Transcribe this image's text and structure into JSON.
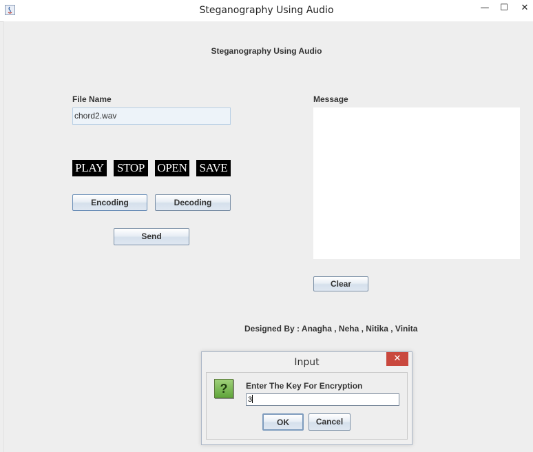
{
  "window": {
    "title": "Steganography Using Audio",
    "min": "—",
    "max": "☐",
    "close": "✕"
  },
  "heading": "Steganography Using Audio",
  "file_section": {
    "label": "File Name",
    "value": "chord2.wav"
  },
  "media_buttons": {
    "play": "PLAY",
    "stop": "STOP",
    "open": "OPEN",
    "save": "SAVE"
  },
  "actions": {
    "encoding": "Encoding",
    "decoding": "Decoding",
    "send": "Send"
  },
  "message_section": {
    "label": "Message",
    "value": "",
    "clear": "Clear"
  },
  "credits": "Designed By : Anagha , Neha , Nitika , Vinita",
  "dialog": {
    "title": "Input",
    "close": "✕",
    "icon": "?",
    "prompt": "Enter The Key For Encryption",
    "input_value": "3",
    "ok": "OK",
    "cancel": "Cancel"
  }
}
